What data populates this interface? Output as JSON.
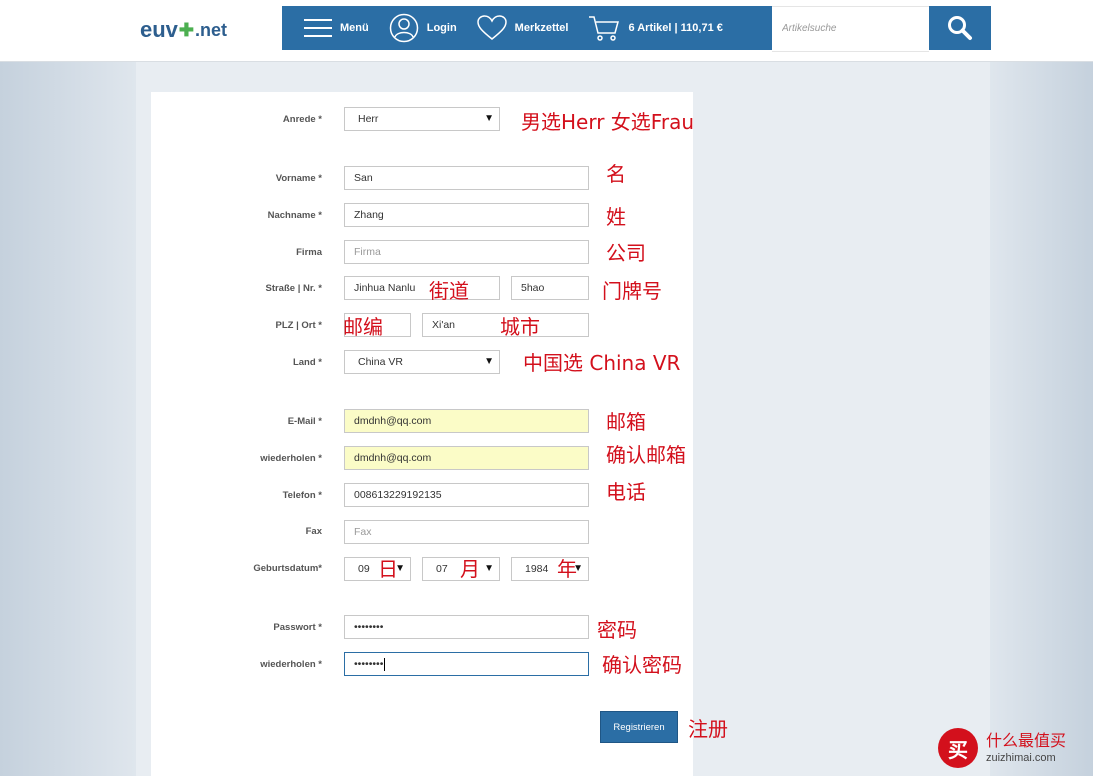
{
  "logo": {
    "prefix": "euv",
    "cross": "✚",
    "tld": ".net"
  },
  "nav": {
    "menu_label": "Menü",
    "login_label": "Login",
    "wishlist_label": "Merkzettel",
    "cart_label": "6 Artikel | 110,71 €"
  },
  "search": {
    "placeholder": "Artikelsuche"
  },
  "form": {
    "salutation": {
      "label": "Anrede *",
      "value": "Herr"
    },
    "first_name": {
      "label": "Vorname *",
      "value": "San"
    },
    "last_name": {
      "label": "Nachname *",
      "value": "Zhang"
    },
    "company": {
      "label": "Firma",
      "placeholder": "Firma"
    },
    "street": {
      "label": "Straße | Nr. *",
      "street_value": "Jinhua Nanlu",
      "number_value": "5hao"
    },
    "zip_city": {
      "label": "PLZ | Ort *",
      "zip_value": "",
      "city_value": "Xi'an"
    },
    "country": {
      "label": "Land *",
      "value": "China VR"
    },
    "email": {
      "label": "E-Mail *",
      "value": "dmdnh@qq.com"
    },
    "email_repeat": {
      "label": "wiederholen *",
      "value": "dmdnh@qq.com"
    },
    "phone": {
      "label": "Telefon *",
      "value": "008613229192135"
    },
    "fax": {
      "label": "Fax",
      "placeholder": "Fax"
    },
    "birthdate": {
      "label": "Geburtsdatum*",
      "day": "09",
      "month": "07",
      "year": "1984"
    },
    "password": {
      "label": "Passwort *",
      "value": "••••••••"
    },
    "password_repeat": {
      "label": "wiederholen *",
      "value": "••••••••"
    },
    "submit_label": "Registrieren"
  },
  "annotations": {
    "salutation": "男选Herr 女选Frau",
    "first_name": "名",
    "last_name": "姓",
    "company": "公司",
    "street": "街道",
    "number": "门牌号",
    "zip": "邮编",
    "city": "城市",
    "country": "中国选 China VR",
    "email": "邮箱",
    "email_repeat": "确认邮箱",
    "phone": "电话",
    "day": "日",
    "month": "月",
    "year": "年",
    "password": "密码",
    "password_repeat": "确认密码",
    "submit": "注册"
  },
  "watermark": {
    "badge": "买",
    "cn": "什么最值买",
    "url": "zuizhimai.com"
  },
  "colors": {
    "brand_blue": "#2b6ea5",
    "annotation_red": "#d3101c",
    "autofill_yellow": "#fbfcc7"
  }
}
